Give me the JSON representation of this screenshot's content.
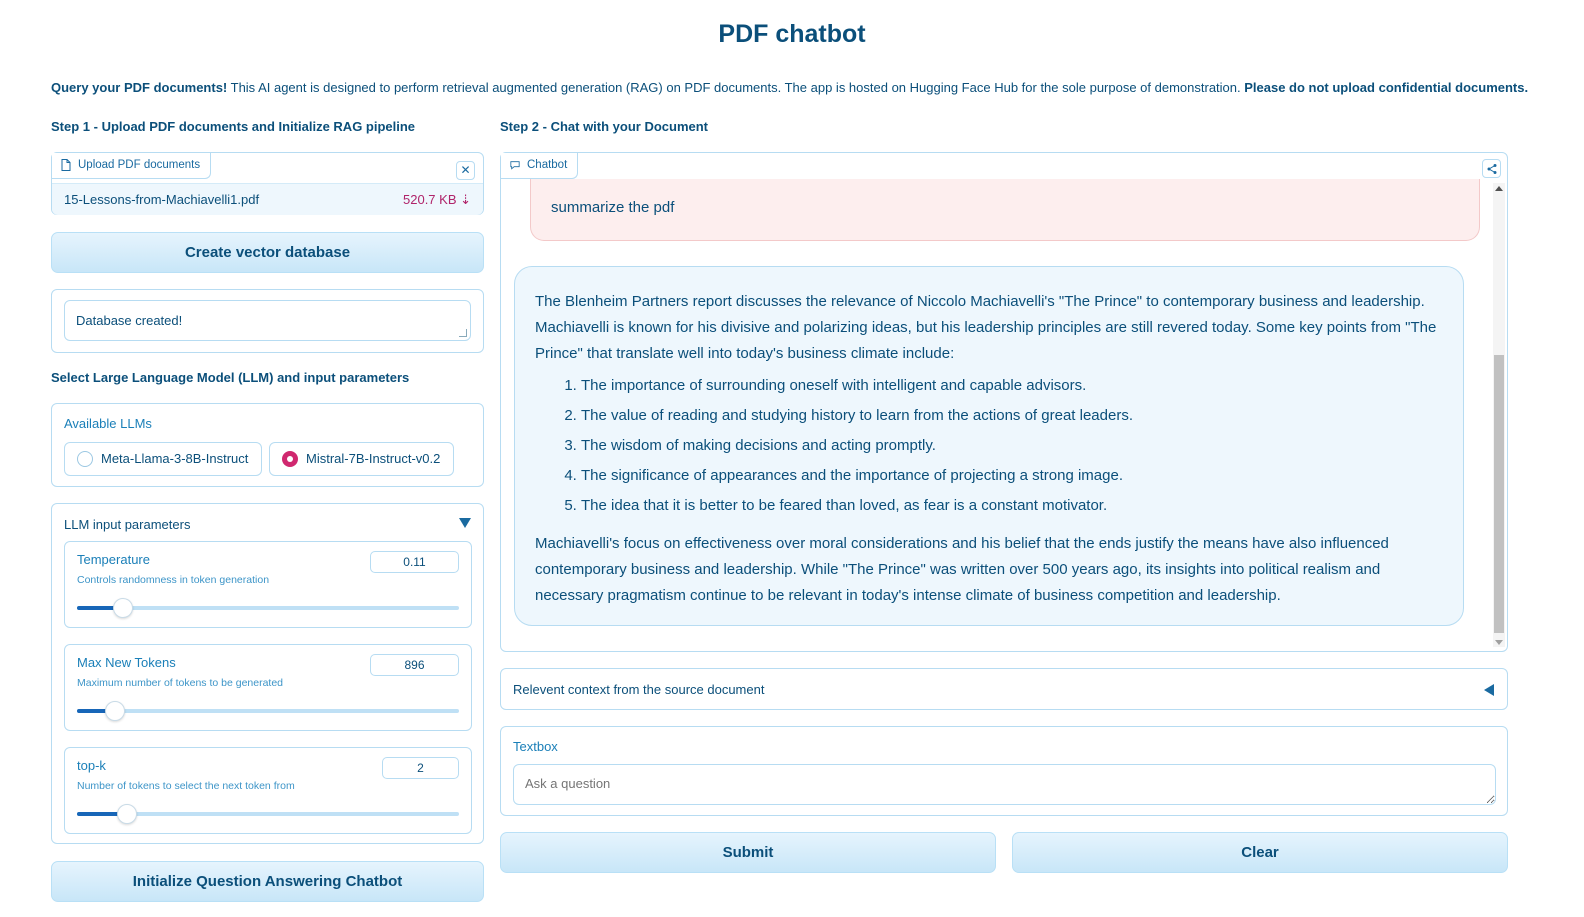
{
  "app": {
    "title": "PDF chatbot",
    "intro_bold_start": "Query your PDF documents!",
    "intro_text": " This AI agent is designed to perform retrieval augmented generation (RAG) on PDF documents. The app is hosted on Hugging Face Hub for the sole purpose of demonstration. ",
    "intro_bold_end": "Please do not upload confidential documents."
  },
  "step1": {
    "label": "Step 1 - Upload PDF documents and Initialize RAG pipeline",
    "upload_tag": "Upload PDF documents",
    "file_name": "15-Lessons-from-Machiavelli1.pdf",
    "file_size": "520.7 KB ⇣",
    "create_db_button": "Create vector database",
    "db_status": "Database created!",
    "llm_section_label": "Select Large Language Model (LLM) and input parameters",
    "available_llms_label": "Available LLMs",
    "llm_options": [
      "Meta-Llama-3-8B-Instruct",
      "Mistral-7B-Instruct-v0.2"
    ],
    "llm_selected": "Mistral-7B-Instruct-v0.2",
    "params_accordion_label": "LLM input parameters",
    "params": [
      {
        "name": "Temperature",
        "desc": "Controls randomness in token generation",
        "value": "0.11",
        "fraction": 0.12
      },
      {
        "name": "Max New Tokens",
        "desc": "Maximum number of tokens to be generated",
        "value": "896",
        "fraction": 0.1
      },
      {
        "name": "top-k",
        "desc": "Number of tokens to select the next token from",
        "value": "2",
        "fraction": 0.13
      }
    ],
    "init_button": "Initialize Question Answering Chatbot"
  },
  "step2": {
    "label": "Step 2 - Chat with your Document",
    "chatbot_tag": "Chatbot",
    "user_message": "summarize the pdf",
    "bot_intro": "The Blenheim Partners report discusses the relevance of Niccolo Machiavelli's \"The Prince\" to contemporary business and leadership. Machiavelli is known for his divisive and polarizing ideas, but his leadership principles are still revered today. Some key points from \"The Prince\" that translate well into today's business climate include:",
    "bot_points": [
      "The importance of surrounding oneself with intelligent and capable advisors.",
      "The value of reading and studying history to learn from the actions of great leaders.",
      "The wisdom of making decisions and acting promptly.",
      "The significance of appearances and the importance of projecting a strong image.",
      "The idea that it is better to be feared than loved, as fear is a constant motivator."
    ],
    "bot_conclusion": "Machiavelli's focus on effectiveness over moral considerations and his belief that the ends justify the means have also influenced contemporary business and leadership. While \"The Prince\" was written over 500 years ago, its insights into political realism and necessary pragmatism continue to be relevant in today's intense climate of business competition and leadership.",
    "context_accordion_label": "Relevent context from the source document",
    "textbox_label": "Textbox",
    "textbox_placeholder": "Ask a question",
    "submit_button": "Submit",
    "clear_button": "Clear"
  },
  "colors": {
    "primary_text": "#0b4f7a",
    "accent_pink": "#d0286f",
    "button_fill": "#c8e6f8",
    "user_bubble": "#fdeeee",
    "bot_bubble": "#eef7fd"
  }
}
